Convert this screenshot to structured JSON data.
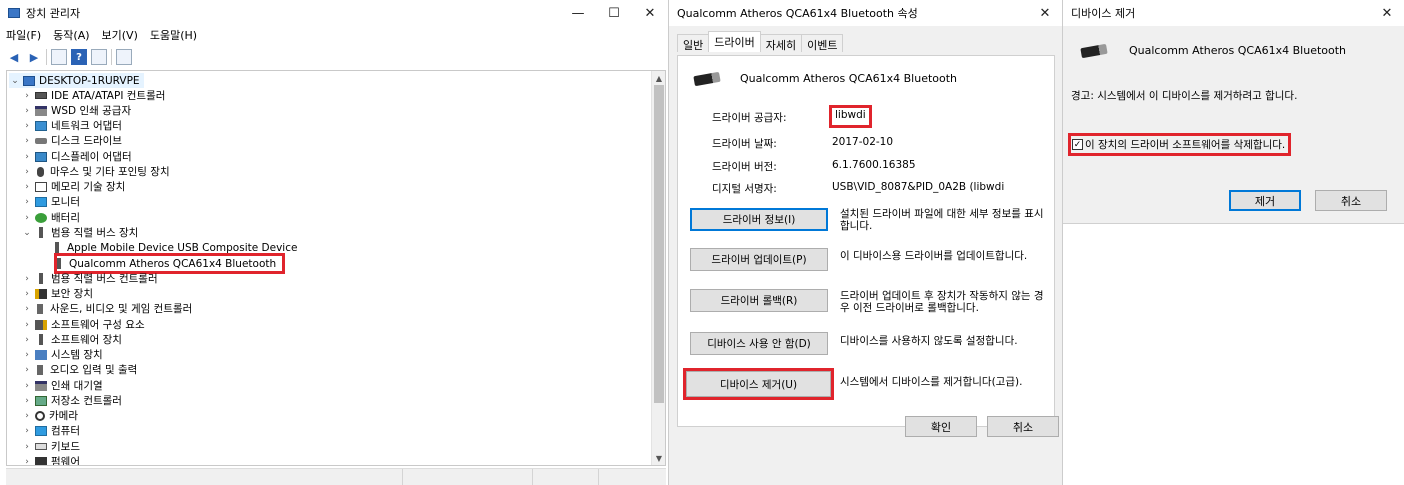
{
  "device_manager": {
    "title": "장치 관리자",
    "controls": {
      "minimize": "—",
      "maximize": "☐",
      "close": "✕"
    },
    "menu": [
      "파일(F)",
      "동작(A)",
      "보기(V)",
      "도움말(H)"
    ],
    "tree": {
      "root": "DESKTOP-1RURVPE",
      "items": [
        {
          "label": "IDE ATA/ATAPI 컨트롤러",
          "toggle": "›"
        },
        {
          "label": "WSD 인쇄 공급자",
          "toggle": "›"
        },
        {
          "label": "네트워크 어댑터",
          "toggle": "›"
        },
        {
          "label": "디스크 드라이브",
          "toggle": "›"
        },
        {
          "label": "디스플레이 어댑터",
          "toggle": "›"
        },
        {
          "label": "마우스 및 기타 포인팅 장치",
          "toggle": "›"
        },
        {
          "label": "메모리 기술 장치",
          "toggle": "›"
        },
        {
          "label": "모니터",
          "toggle": "›"
        },
        {
          "label": "배터리",
          "toggle": "›"
        },
        {
          "label": "범용 직렬 버스 장치",
          "toggle": "⌄"
        },
        {
          "label": "Apple Mobile Device USB Composite Device",
          "toggle": ""
        },
        {
          "label": "Qualcomm Atheros QCA61x4 Bluetooth",
          "toggle": ""
        },
        {
          "label": "범용 직렬 버스 컨트롤러",
          "toggle": "›"
        },
        {
          "label": "보안 장치",
          "toggle": "›"
        },
        {
          "label": "사운드, 비디오 및 게임 컨트롤러",
          "toggle": "›"
        },
        {
          "label": "소프트웨어 구성 요소",
          "toggle": "›"
        },
        {
          "label": "소프트웨어 장치",
          "toggle": "›"
        },
        {
          "label": "시스템 장치",
          "toggle": "›"
        },
        {
          "label": "오디오 입력 및 출력",
          "toggle": "›"
        },
        {
          "label": "인쇄 대기열",
          "toggle": "›"
        },
        {
          "label": "저장소 컨트롤러",
          "toggle": "›"
        },
        {
          "label": "카메라",
          "toggle": "›"
        },
        {
          "label": "컴퓨터",
          "toggle": "›"
        },
        {
          "label": "키보드",
          "toggle": "›"
        },
        {
          "label": "펌웨어",
          "toggle": "›"
        }
      ]
    }
  },
  "properties": {
    "title": "Qualcomm Atheros QCA61x4 Bluetooth 속성",
    "close": "✕",
    "tabs": [
      "일반",
      "드라이버",
      "자세히",
      "이벤트"
    ],
    "active_tab": "드라이버",
    "device_name": "Qualcomm Atheros QCA61x4 Bluetooth",
    "info": [
      {
        "label": "드라이버 공급자:",
        "value": "libwdi"
      },
      {
        "label": "드라이버 날짜:",
        "value": "2017-02-10"
      },
      {
        "label": "드라이버 버전:",
        "value": "6.1.7600.16385"
      },
      {
        "label": "디지털 서명자:",
        "value": "USB\\VID_8087&PID_0A2B (libwdi"
      }
    ],
    "actions": [
      {
        "button": "드라이버 정보(I)",
        "desc": "설치된 드라이버 파일에 대한 세부 정보를 표시합니다."
      },
      {
        "button": "드라이버 업데이트(P)",
        "desc": "이 디바이스용 드라이버를 업데이트합니다."
      },
      {
        "button": "드라이버 롤백(R)",
        "desc": "드라이버 업데이트 후 장치가 작동하지 않는 경우 이전 드라이버로 롤백합니다."
      },
      {
        "button": "디바이스 사용 안 함(D)",
        "desc": "디바이스를 사용하지 않도록 설정합니다."
      },
      {
        "button": "디바이스 제거(U)",
        "desc": "시스템에서 디바이스를 제거합니다(고급)."
      }
    ],
    "ok": "확인",
    "cancel": "취소"
  },
  "uninstall": {
    "title": "디바이스 제거",
    "close": "✕",
    "device_name": "Qualcomm Atheros QCA61x4 Bluetooth",
    "warning": "경고: 시스템에서 이 디바이스를 제거하려고 합니다.",
    "checkbox_label": "이 장치의 드라이버 소프트웨어를 삭제합니다.",
    "checkbox_checked": true,
    "remove": "제거",
    "cancel": "취소"
  },
  "colors": {
    "highlight": "#e0242c",
    "accent": "#0078d7"
  }
}
